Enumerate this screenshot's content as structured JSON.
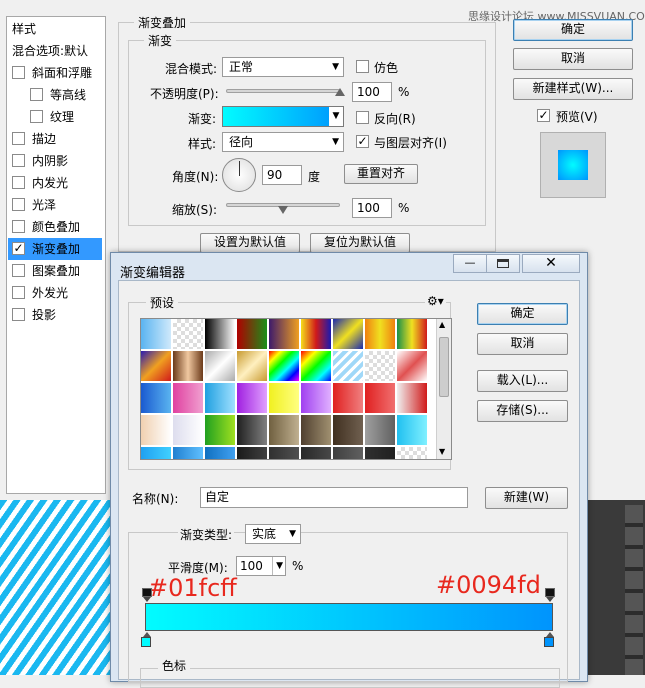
{
  "layer_style": {
    "sidebar_title": "样式",
    "sidebar_items": [
      {
        "label": "混合选项:默认",
        "checkbox": false,
        "checked": false,
        "indent": 0,
        "selected": false
      },
      {
        "label": "斜面和浮雕",
        "checkbox": true,
        "checked": false,
        "indent": 0,
        "selected": false
      },
      {
        "label": "等高线",
        "checkbox": true,
        "checked": false,
        "indent": 1,
        "selected": false
      },
      {
        "label": "纹理",
        "checkbox": true,
        "checked": false,
        "indent": 1,
        "selected": false
      },
      {
        "label": "描边",
        "checkbox": true,
        "checked": false,
        "indent": 0,
        "selected": false
      },
      {
        "label": "内阴影",
        "checkbox": true,
        "checked": false,
        "indent": 0,
        "selected": false
      },
      {
        "label": "内发光",
        "checkbox": true,
        "checked": false,
        "indent": 0,
        "selected": false
      },
      {
        "label": "光泽",
        "checkbox": true,
        "checked": false,
        "indent": 0,
        "selected": false
      },
      {
        "label": "颜色叠加",
        "checkbox": true,
        "checked": false,
        "indent": 0,
        "selected": false
      },
      {
        "label": "渐变叠加",
        "checkbox": true,
        "checked": true,
        "indent": 0,
        "selected": true
      },
      {
        "label": "图案叠加",
        "checkbox": true,
        "checked": false,
        "indent": 0,
        "selected": false
      },
      {
        "label": "外发光",
        "checkbox": true,
        "checked": false,
        "indent": 0,
        "selected": false
      },
      {
        "label": "投影",
        "checkbox": true,
        "checked": false,
        "indent": 0,
        "selected": false
      }
    ],
    "group_title": "渐变叠加",
    "subgroup_title": "渐变",
    "blend_mode_label": "混合模式:",
    "blend_mode_value": "正常",
    "dither_label": "仿色",
    "opacity_label": "不透明度(P):",
    "opacity_value": "100",
    "opacity_unit": "%",
    "opacity_level": 1.0,
    "gradient_label": "渐变:",
    "reverse_label": "反向(R)",
    "style_label": "样式:",
    "style_value": "径向",
    "align_label": "与图层对齐(I)",
    "angle_label": "角度(N):",
    "angle_value": "90",
    "angle_unit": "度",
    "reset_align_button": "重置对齐",
    "scale_label": "缩放(S):",
    "scale_value": "100",
    "scale_unit": "%",
    "scale_level": 0.5,
    "set_default_button": "设置为默认值",
    "reset_default_button": "复位为默认值",
    "ok_button": "确定",
    "cancel_button": "取消",
    "new_style_button": "新建样式(W)...",
    "preview_label": "预览(V)"
  },
  "gradient_editor": {
    "title": "渐变编辑器",
    "presets_label": "预设",
    "ok_button": "确定",
    "cancel_button": "取消",
    "load_button": "载入(L)...",
    "save_button": "存储(S)...",
    "name_label": "名称(N):",
    "name_value": "自定",
    "new_button": "新建(W)",
    "gradient_type_label": "渐变类型:",
    "gradient_type_value": "实底",
    "smoothness_label": "平滑度(M):",
    "smoothness_value": "100",
    "smoothness_unit": "%",
    "color_stops_label": "色标",
    "annotation_left": "#01fcff",
    "annotation_right": "#0094fd",
    "stop_left_color": "#01fcff",
    "stop_right_color": "#0094fd"
  },
  "watermark": "思缘设计论坛 www.MISSVUAN.COM",
  "colors": {
    "selected": "#3399ff",
    "annotation": "#e8281e"
  }
}
